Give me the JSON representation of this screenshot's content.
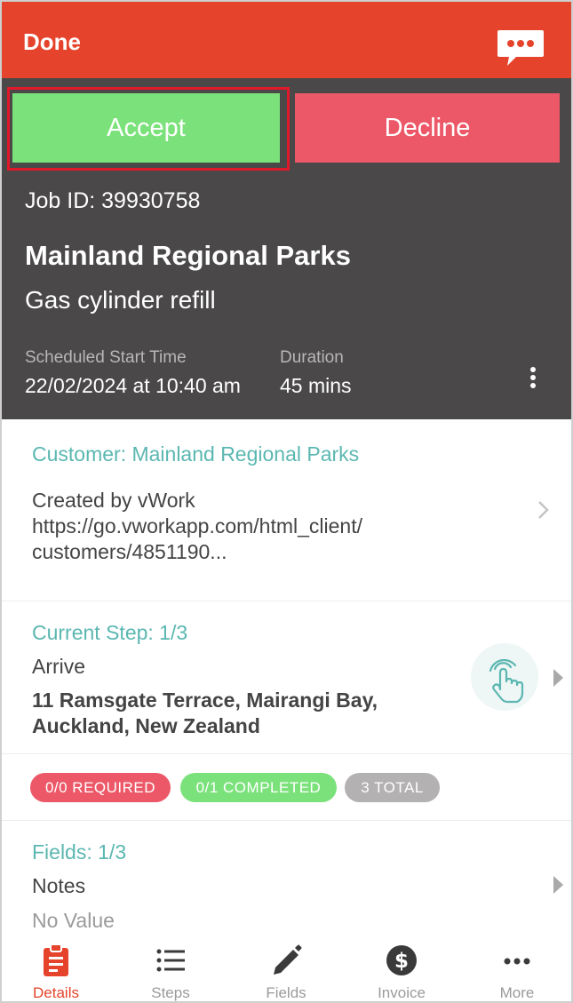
{
  "header": {
    "done_label": "Done",
    "accept_label": "Accept",
    "decline_label": "Decline"
  },
  "job": {
    "id_text": "Job ID: 39930758",
    "customer_name": "Mainland Regional Parks",
    "job_type": "Gas cylinder refill",
    "start_label": "Scheduled Start Time",
    "start_value": "22/02/2024 at 10:40 am",
    "duration_label": "Duration",
    "duration_value": "45 mins"
  },
  "customer": {
    "title": "Customer: Mainland Regional Parks",
    "line1": "Created by vWork",
    "line2": "https://go.vworkapp.com/html_client/",
    "line3": "customers/4851190..."
  },
  "step": {
    "title": "Current Step: 1/3",
    "name": "Arrive",
    "address_line1": "11 Ramsgate Terrace, Mairangi Bay,",
    "address_line2": "Auckland, New Zealand"
  },
  "badges": {
    "required": "0/0 REQUIRED",
    "completed": "0/1 COMPLETED",
    "total": "3 TOTAL"
  },
  "fields": {
    "title": "Fields: 1/3",
    "name": "Notes",
    "value": "No Value"
  },
  "nav": [
    {
      "label": "Details",
      "icon": "clipboard-icon"
    },
    {
      "label": "Steps",
      "icon": "list-icon"
    },
    {
      "label": "Fields",
      "icon": "pencil-icon"
    },
    {
      "label": "Invoice",
      "icon": "dollar-icon"
    },
    {
      "label": "More",
      "icon": "more-icon"
    }
  ],
  "colors": {
    "brand": "#e5432b",
    "accept": "#7be27b",
    "decline": "#ec5868",
    "teal": "#5bb7b1"
  }
}
